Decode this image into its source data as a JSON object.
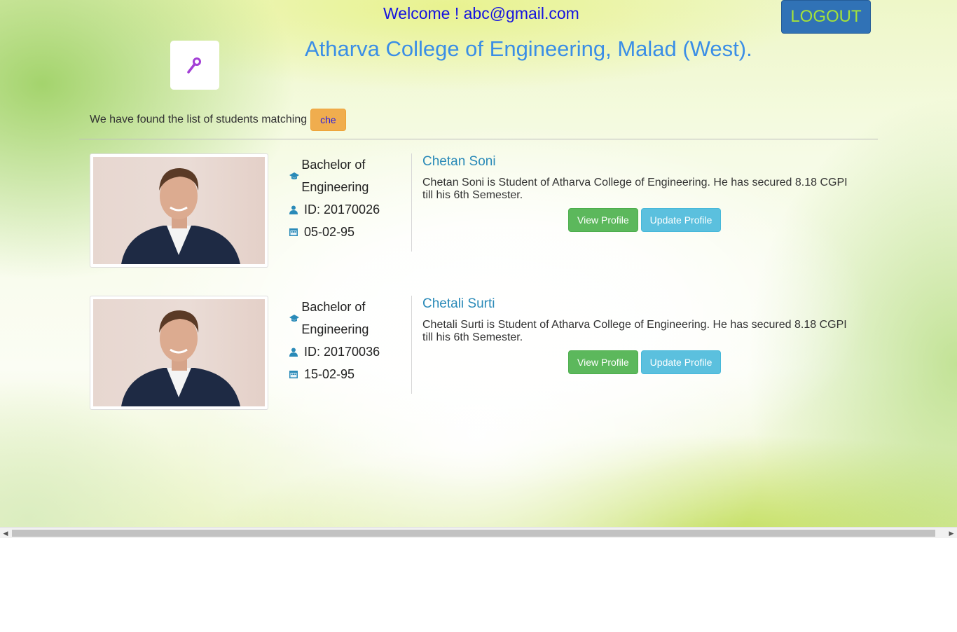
{
  "header": {
    "welcome": "Welcome ! abc@gmail.com",
    "logout_label": "LOGOUT",
    "college_name": "Atharva College of Engineering, Malad (West).",
    "logo_icon": "key-icon"
  },
  "search": {
    "intro": "We have found the list of students matching",
    "query": "che"
  },
  "students": [
    {
      "course": "Bachelor of Engineering",
      "id": "ID: 20170026",
      "dob": "05-02-95",
      "name": "Chetan Soni",
      "description": "Chetan Soni is Student of Atharva College of Engineering. He has secured 8.18 CGPI till his 6th Semester.",
      "view_label": "View Profile",
      "update_label": "Update Profile"
    },
    {
      "course": "Bachelor of Engineering",
      "id": "ID: 20170036",
      "dob": "15-02-95",
      "name": "Chetali Surti",
      "description": "Chetali Surti is Student of Atharva College of Engineering. He has secured 8.18 CGPI till his 6th Semester.",
      "view_label": "View Profile",
      "update_label": "Update Profile"
    }
  ],
  "colors": {
    "welcome": "#1412e0",
    "logout_bg": "#3072b6",
    "logout_text": "#a4e23a",
    "title": "#3a8ee6",
    "badge": "#f0ad4e",
    "name": "#2a8ab8",
    "btn_view": "#5cb85c",
    "btn_update": "#5bc0de"
  }
}
